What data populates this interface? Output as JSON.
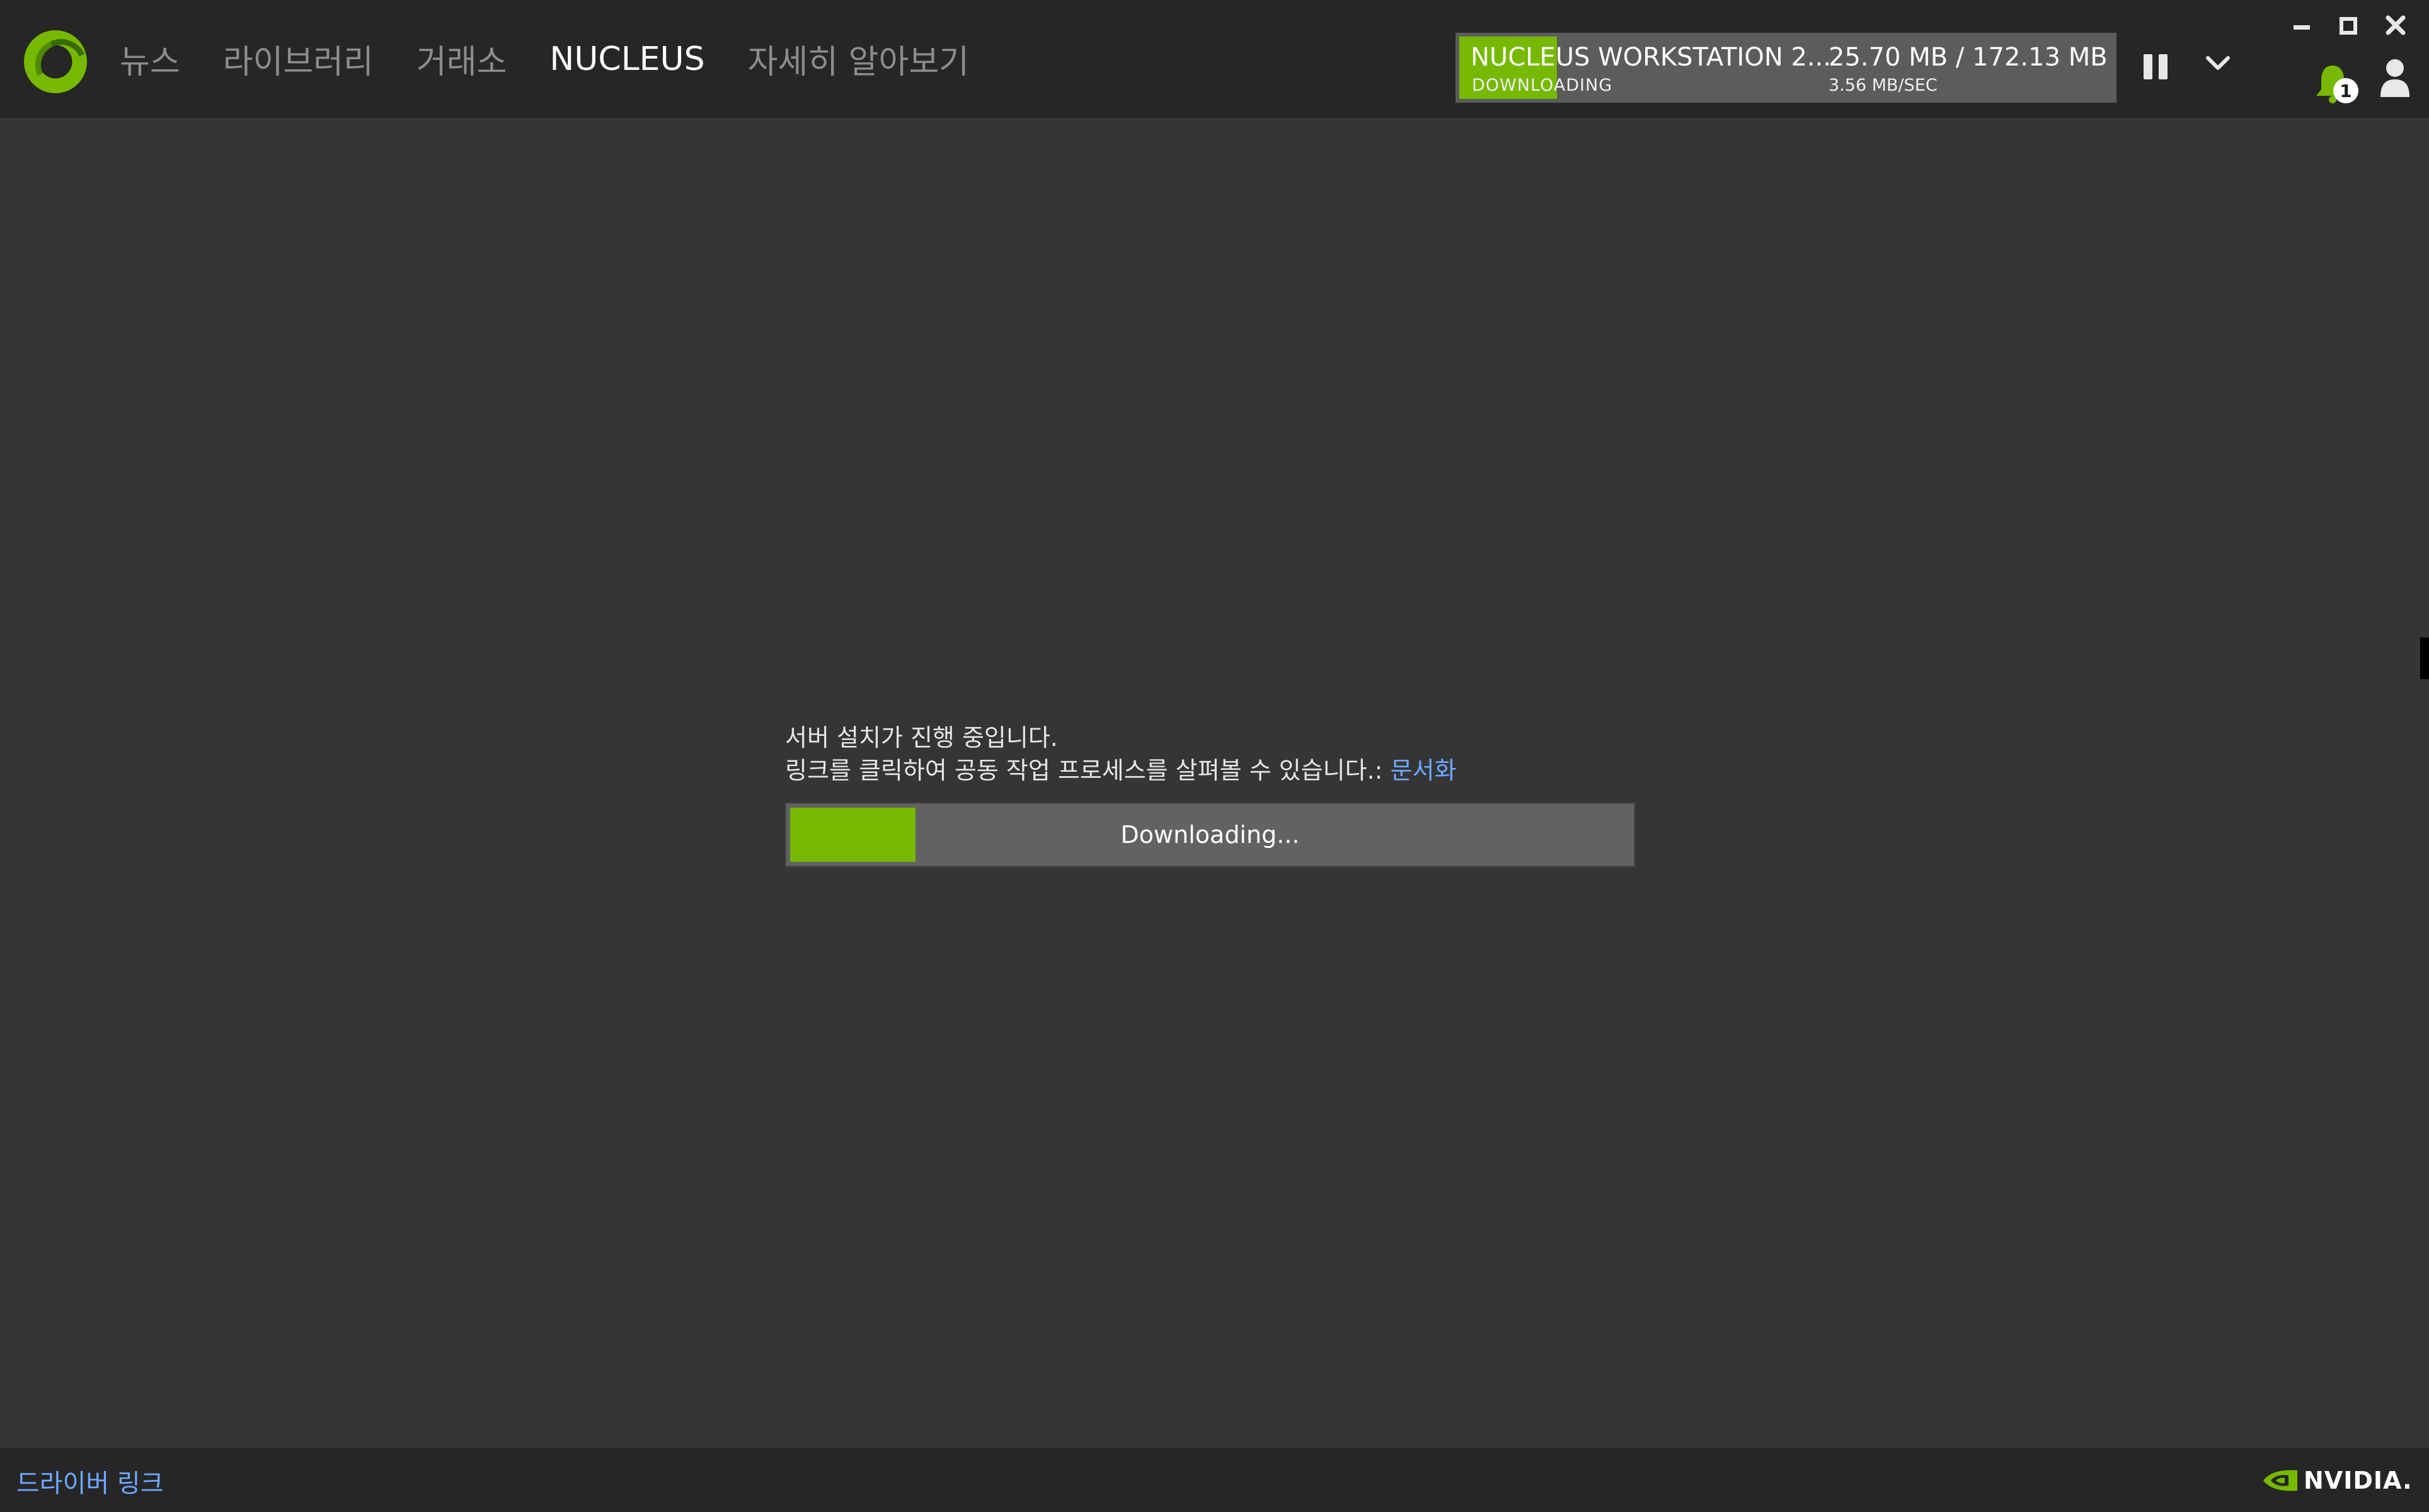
{
  "nav": {
    "items": [
      {
        "label": "뉴스",
        "active": false
      },
      {
        "label": "라이브러리",
        "active": false
      },
      {
        "label": "거래소",
        "active": false
      },
      {
        "label": "NUCLEUS",
        "active": true
      },
      {
        "label": "자세히 알아보기",
        "active": false
      }
    ]
  },
  "download": {
    "name": "NUCLEUS WORKSTATION 2...",
    "status": "DOWNLOADING",
    "size": "25.70 MB / 172.13 MB",
    "speed": "3.56 MB/SEC",
    "progress": 0.149
  },
  "notifications": {
    "count": "1"
  },
  "main": {
    "line1": "서버 설치가 진행 중입니다.",
    "line2": "링크를 클릭하여 공동 작업 프로세스를 살펴볼 수 있습니다.: ",
    "doc_link": "문서화",
    "progress_label": "Downloading...",
    "progress": 0.149
  },
  "footer": {
    "driver_link": "드라이버 링크",
    "brand": "NVIDIA."
  },
  "colors": {
    "accent": "#76b900",
    "link": "#6ea8ff",
    "topbar": "#262626",
    "background": "#353535"
  }
}
